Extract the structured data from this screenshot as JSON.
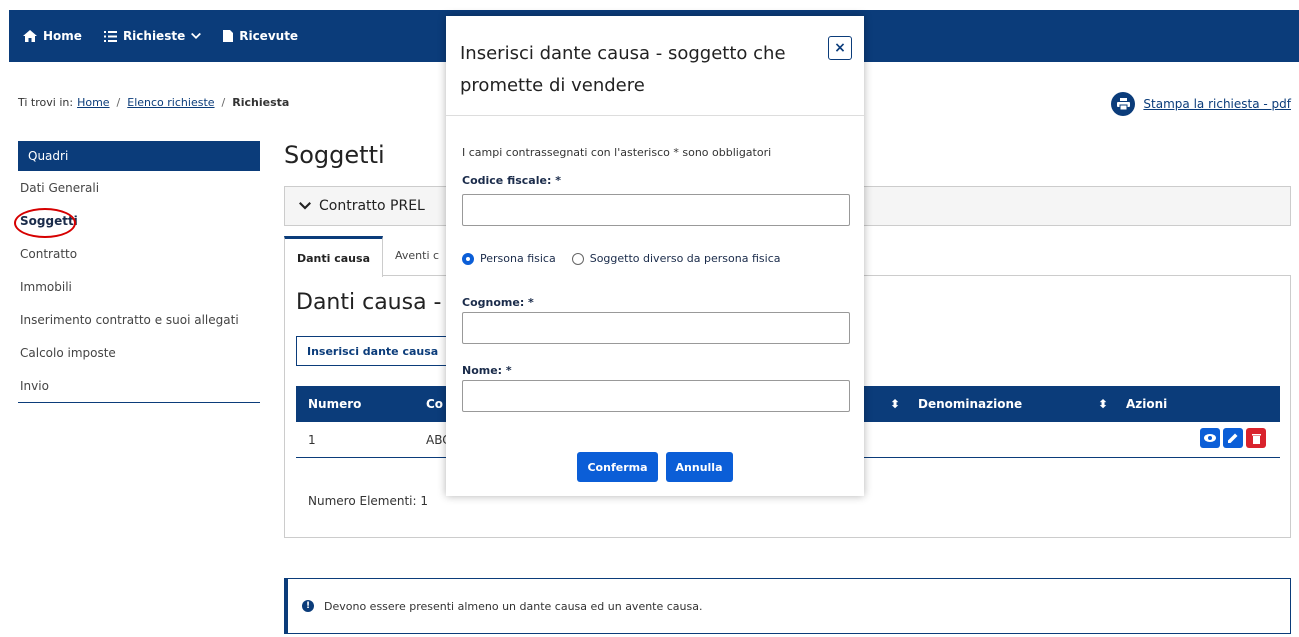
{
  "nav": {
    "home": "Home",
    "richieste": "Richieste",
    "ricevute": "Ricevute"
  },
  "breadcrumb": {
    "prefix": "Ti trovi in:",
    "home": "Home",
    "elenco": "Elenco richieste",
    "current": "Richiesta",
    "sep": "/"
  },
  "print_link": "Stampa la richiesta - pdf",
  "sidebar": {
    "header": "Quadri",
    "items": [
      {
        "label": "Dati Generali"
      },
      {
        "label": "Soggetti"
      },
      {
        "label": "Contratto"
      },
      {
        "label": "Immobili"
      },
      {
        "label": "Inserimento contratto e suoi allegati"
      },
      {
        "label": "Calcolo imposte"
      },
      {
        "label": "Invio"
      }
    ]
  },
  "main": {
    "title": "Soggetti",
    "accordion": "Contratto PREL",
    "tabs": [
      "Danti causa",
      "Aventi c"
    ],
    "section_title": "Danti causa -",
    "insert_button": "Inserisci dante causa",
    "table": {
      "headers": [
        "Numero",
        "Co",
        "Denominazione",
        "Azioni"
      ],
      "rows": [
        {
          "numero": "1",
          "codice": "ABC"
        }
      ]
    },
    "num_elements": "Numero Elementi: 1",
    "alert": "Devono essere presenti almeno un dante causa ed un avente causa."
  },
  "modal": {
    "title": "Inserisci dante causa - soggetto che promette di vendere",
    "close": "×",
    "note": "I campi contrassegnati con l'asterisco * sono obbligatori",
    "codice_label": "Codice fiscale: *",
    "radio_fisica": "Persona fisica",
    "radio_diverso": "Soggetto diverso da persona fisica",
    "cognome_label": "Cognome: *",
    "nome_label": "Nome: *",
    "confirm": "Conferma",
    "cancel": "Annulla"
  },
  "colors": {
    "primary": "#0b3c7a",
    "button": "#0b5ed7",
    "highlight": "#d60000",
    "delete": "#d9232d"
  }
}
